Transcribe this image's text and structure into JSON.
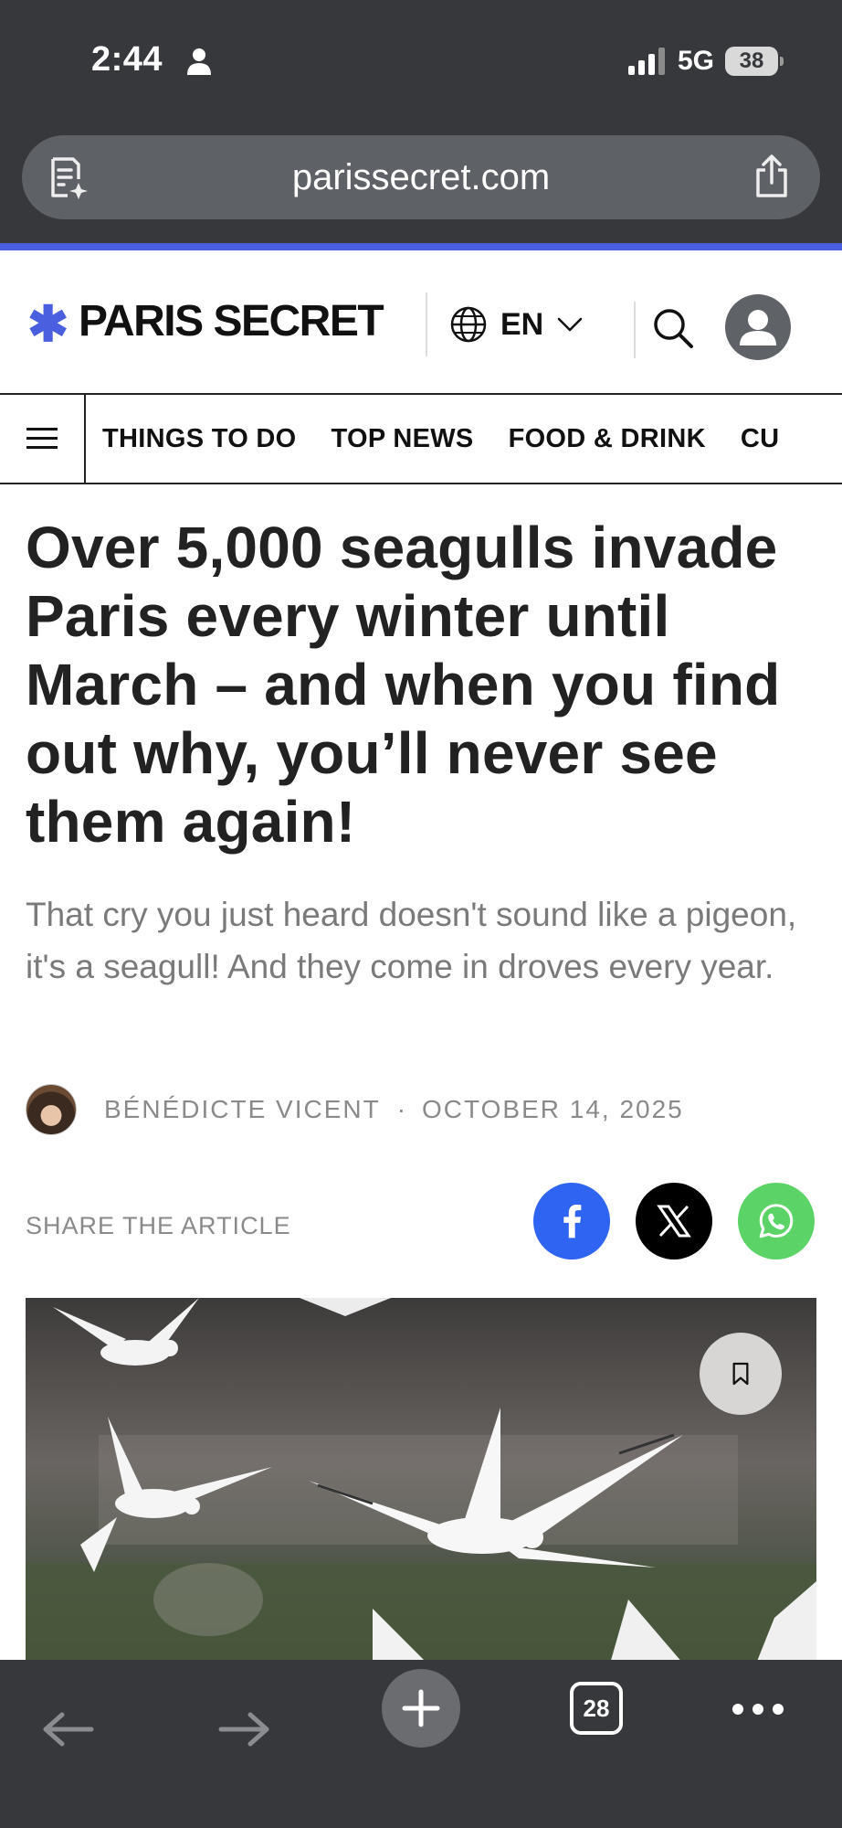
{
  "status_bar": {
    "time": "2:44",
    "network": "5G",
    "battery": "38"
  },
  "browser": {
    "url": "parissecret.com",
    "tab_count": "28"
  },
  "site": {
    "logo": "PARIS SECRET",
    "language": "EN",
    "nav": [
      "THINGS TO DO",
      "TOP NEWS",
      "FOOD & DRINK",
      "CU"
    ]
  },
  "article": {
    "headline": "Over 5,000 seagulls invade Paris every winter until March – and when you find out why, you’ll never see them again!",
    "subheadline": "That cry you just heard doesn't sound like a pigeon, it's a seagull! And they come in droves every year.",
    "author": "BÉNÉDICTE VICENT",
    "separator": "·",
    "date": "OCTOBER 14, 2025",
    "share_label": "SHARE THE ARTICLE"
  },
  "colors": {
    "accent": "#4a5fe0",
    "facebook": "#2f64f2",
    "x": "#000000",
    "whatsapp": "#5bd366",
    "chrome": "#36383c"
  },
  "icons": [
    "person-icon",
    "signal-icon",
    "reader-mode-icon",
    "share-icon",
    "globe-icon",
    "chevron-down-icon",
    "search-icon",
    "user-icon",
    "hamburger-icon",
    "facebook-icon",
    "x-icon",
    "whatsapp-icon",
    "bookmark-icon",
    "back-icon",
    "forward-icon",
    "new-tab-icon",
    "tabs-icon",
    "more-icon"
  ]
}
